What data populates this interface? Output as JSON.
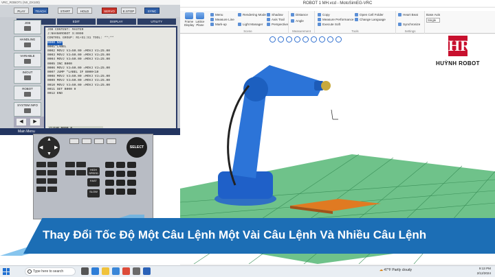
{
  "window_title": "ROBOT 1 MH.vcd - MotoSimEG-VRC",
  "ribbon": {
    "home_label": "Home",
    "groups": [
      {
        "label": "Scene"
      },
      {
        "label": "Measurement"
      },
      {
        "label": "Tools"
      },
      {
        "label": "Settings"
      }
    ],
    "items": [
      "Menu",
      "Measure Line",
      "Mark-up",
      "Rendering Mode",
      "Light Manager",
      "Shadow",
      "Axis Trail",
      "Perspective",
      "Distance",
      "Angle",
      "Copy",
      "Measure Performance",
      "Execute Soft",
      "Open Cell Folder",
      "Change Language",
      "Heart Beat",
      "Synchronize",
      "Base Axis"
    ],
    "big_buttons": [
      "Frame Display",
      "Lattice Plane"
    ],
    "base_axis_value": "Single",
    "settings_label": "Settings"
  },
  "brand": {
    "logo": "HR",
    "name": "HUỲNH ROBOT"
  },
  "pendant": {
    "title": "VRC_ROBOT1 (NX_DX100)",
    "modes": [
      "PLAY",
      "TEACH",
      "START",
      "HOLD",
      "SERVO ON",
      "E.STOP",
      "SYNC"
    ],
    "menu_tabs": [
      "JOB",
      "EDIT",
      "DISPLAY",
      "UTILITY"
    ],
    "side_buttons": [
      "JOB",
      "HANDLING",
      "VARIABLE",
      "IN/OUT",
      "ROBOT",
      "SYSTEM INFO"
    ],
    "job": {
      "header": [
        "JOB CONTENT: MASTER",
        "J:NHANHROBOT          S:0000",
        "CONTROL GROUP: R1+S1:S1    TOOL: **:**"
      ],
      "lines": [
        "0000 NOP",
        "0001*LABEL",
        "0002 MOVJ VJ=50.00    =MOVJ VJ=25.00",
        "0003 MOVJ VJ=50.00    =MOVJ VJ=25.00",
        "0004 MOVJ VJ=50.00    =MOVJ VJ=25.00",
        "0005 INC B000",
        "0006 MOVJ VJ=50.00    =MOVJ VJ=25.00",
        "0007 JUMP *LABEL IF B000<10",
        "0008 MOVJ VJ=50.00    =MOVJ VJ=25.00",
        "0009 MOVJ VJ=50.00    =MOVJ VJ=25.00",
        "0010 MOVJ VJ=50.00    =MOVJ VJ=25.00",
        "0011 SET B000 0",
        "0012 END"
      ],
      "command": "CLEAR B000 0"
    },
    "status": "Main Menu",
    "select_label": "SELECT",
    "speed_labels": [
      "HIGH SPEED",
      "FAST",
      "SLOW"
    ]
  },
  "banner": {
    "text": "Thay Đổi Tốc Độ Một Câu Lệnh Một Vài Câu Lệnh Và Nhiều Câu Lệnh"
  },
  "taskbar": {
    "search_placeholder": "Type here to search",
    "weather": "47°F  Partly cloudy",
    "time": "9:13 PM",
    "date": "2/12/2024"
  }
}
